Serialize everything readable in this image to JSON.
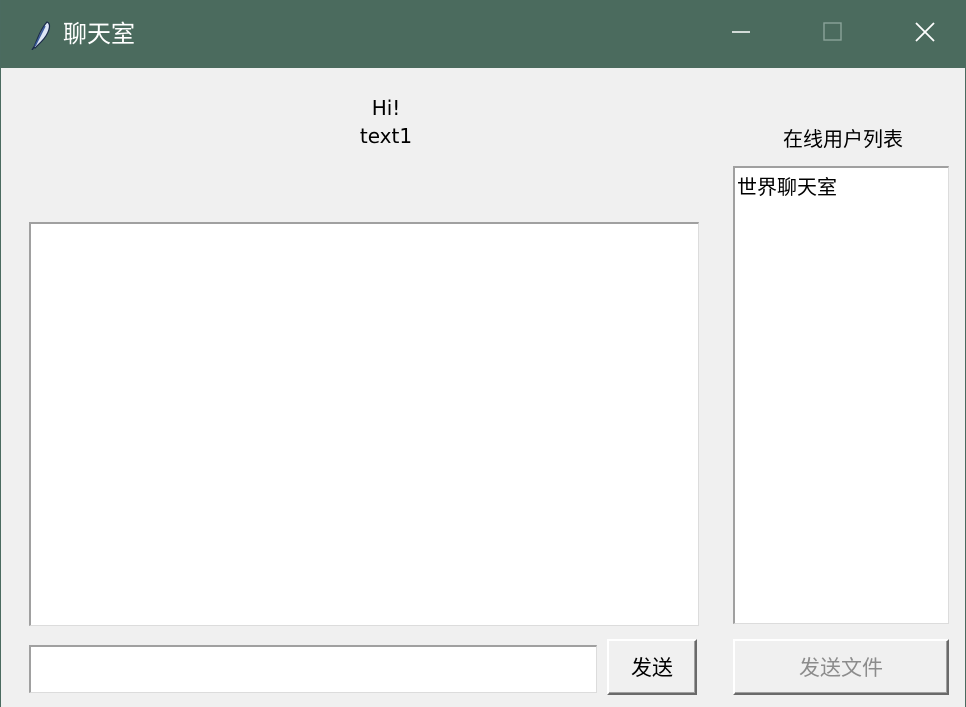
{
  "window": {
    "title": "聊天室",
    "icon": "feather-icon",
    "titlebar_color": "#4b6b5e"
  },
  "controls": {
    "minimize_icon": "minimize-icon",
    "maximize_icon": "maximize-icon",
    "close_icon": "close-icon"
  },
  "greeting": {
    "line1": "Hi!",
    "line2": "text1"
  },
  "users": {
    "label": "在线用户列表",
    "items": [
      "世界聊天室"
    ]
  },
  "input": {
    "value": "",
    "placeholder": ""
  },
  "buttons": {
    "send": "发送",
    "send_file": "发送文件"
  }
}
